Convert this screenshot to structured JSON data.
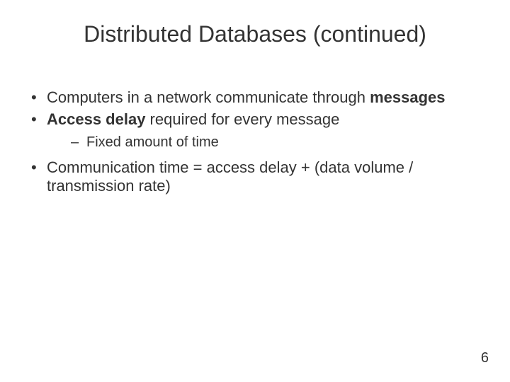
{
  "title": "Distributed Databases (continued)",
  "bullets": {
    "b1_a": "Computers in a network communicate through ",
    "b1_b": "messages",
    "b2_a": "Access delay",
    "b2_b": " required for every message",
    "sub1": "Fixed amount of time",
    "b3": "Communication time = access delay + (data volume / transmission rate)"
  },
  "page_number": "6"
}
